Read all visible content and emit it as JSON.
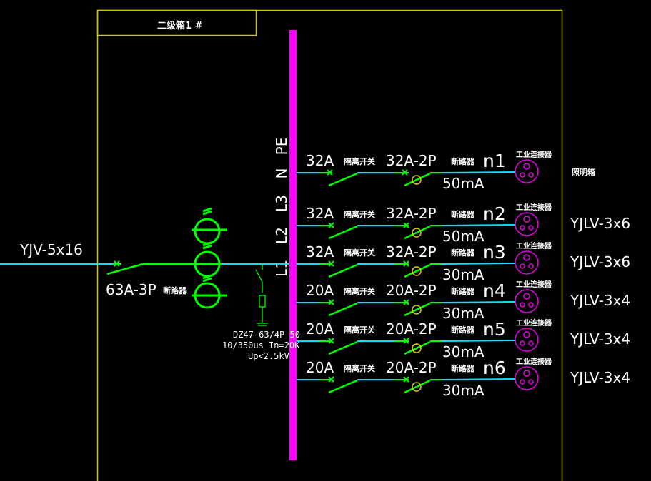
{
  "title": "二级箱1 #",
  "colors": {
    "background": "#000000",
    "frame": "#c8c800",
    "busbar": "#ff00ff",
    "wire": "#00e5ff",
    "device": "#00ff00",
    "rcd": "#e6c800",
    "connector": "#e600e6"
  },
  "bus_labels": [
    "PE",
    "N",
    "L3",
    "L2",
    "L1"
  ],
  "incoming": {
    "cable": "YJV-5x16",
    "breaker_rating": "63A-3P",
    "breaker_label": "断路器",
    "spd_lines": [
      "DZ47-63/4P 50",
      "10/350us In=20K",
      "Up<2.5kV"
    ]
  },
  "right_label": "照明箱",
  "circuits": [
    {
      "iso_rating": "32A",
      "iso_label": "隔离开关",
      "cb_rating": "32A-2P",
      "cb_label": "断路器",
      "name": "n1",
      "rcd": "50mA",
      "load": "工业连接器",
      "cable": ""
    },
    {
      "iso_rating": "32A",
      "iso_label": "隔离开关",
      "cb_rating": "32A-2P",
      "cb_label": "断路器",
      "name": "n2",
      "rcd": "50mA",
      "load": "工业连接器",
      "cable": "YJLV-3x6"
    },
    {
      "iso_rating": "32A",
      "iso_label": "隔离开关",
      "cb_rating": "32A-2P",
      "cb_label": "断路器",
      "name": "n3",
      "rcd": "30mA",
      "load": "工业连接器",
      "cable": "YJLV-3x6"
    },
    {
      "iso_rating": "20A",
      "iso_label": "隔离开关",
      "cb_rating": "20A-2P",
      "cb_label": "断路器",
      "name": "n4",
      "rcd": "30mA",
      "load": "工业连接器",
      "cable": "YJLV-3x4"
    },
    {
      "iso_rating": "20A",
      "iso_label": "隔离开关",
      "cb_rating": "20A-2P",
      "cb_label": "断路器",
      "name": "n5",
      "rcd": "30mA",
      "load": "工业连接器",
      "cable": "YJLV-3x4"
    },
    {
      "iso_rating": "20A",
      "iso_label": "隔离开关",
      "cb_rating": "20A-2P",
      "cb_label": "断路器",
      "name": "n6",
      "rcd": "30mA",
      "load": "工业连接器",
      "cable": "YJLV-3x4"
    }
  ]
}
